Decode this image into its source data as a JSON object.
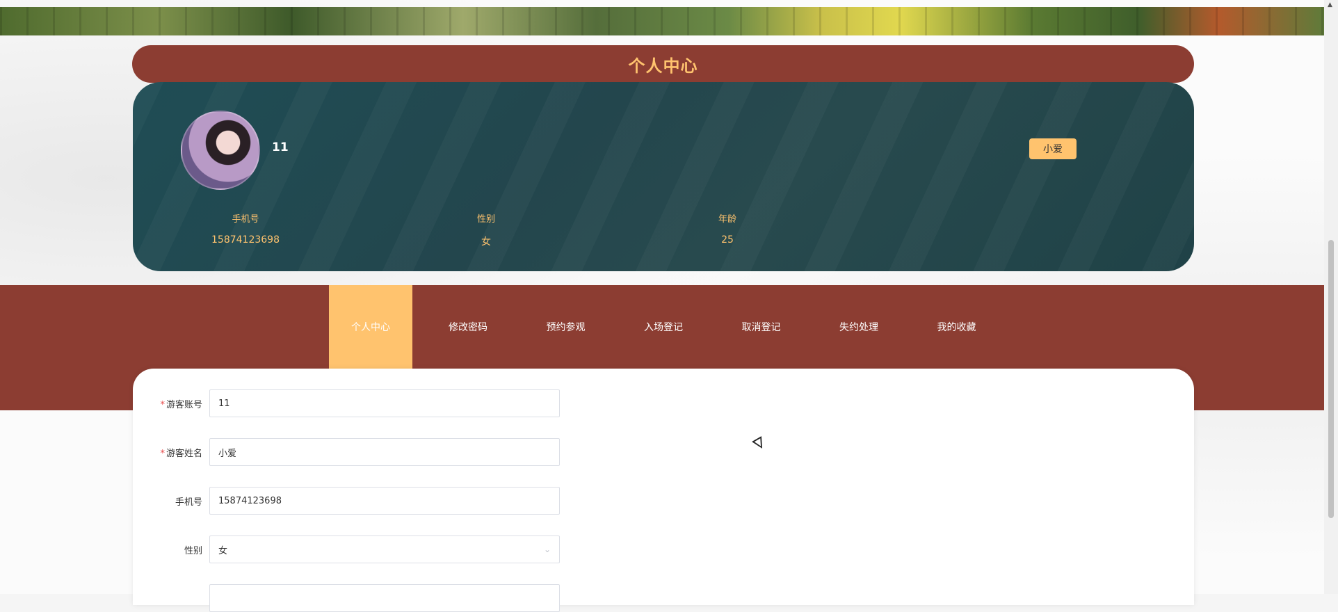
{
  "page": {
    "title": "个人中心"
  },
  "profile": {
    "username": "11",
    "name_badge": "小爱",
    "fields": [
      {
        "label": "手机号",
        "value": "15874123698"
      },
      {
        "label": "性别",
        "value": "女"
      },
      {
        "label": "年龄",
        "value": "25"
      }
    ]
  },
  "nav": {
    "items": [
      {
        "label": "个人中心",
        "active": true
      },
      {
        "label": "修改密码",
        "active": false
      },
      {
        "label": "预约参观",
        "active": false
      },
      {
        "label": "入场登记",
        "active": false
      },
      {
        "label": "取消登记",
        "active": false
      },
      {
        "label": "失约处理",
        "active": false
      },
      {
        "label": "我的收藏",
        "active": false
      }
    ]
  },
  "form": {
    "fields": [
      {
        "label": "游客账号",
        "required": true,
        "value": "11"
      },
      {
        "label": "游客姓名",
        "required": true,
        "value": "小爱"
      },
      {
        "label": "手机号",
        "required": false,
        "value": "15874123698"
      },
      {
        "label": "性别",
        "required": false,
        "value": "女",
        "type": "select"
      }
    ]
  },
  "colors": {
    "primary": "#8c3d32",
    "accent": "#ffc36e",
    "card": "#23464d"
  },
  "icons": {
    "select_chevron": "chevron-down-icon"
  }
}
